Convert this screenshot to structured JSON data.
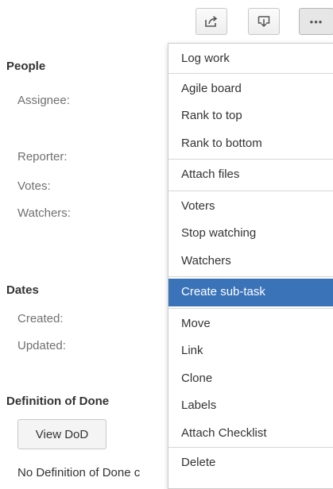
{
  "toolbar": {
    "buttons": [
      {
        "icon": "share-icon"
      },
      {
        "icon": "export-icon"
      },
      {
        "icon": "more-icon",
        "label": "•••"
      }
    ]
  },
  "people": {
    "title": "People",
    "assignee_label": "Assignee:",
    "reporter_label": "Reporter:",
    "votes_label": "Votes:",
    "watchers_label": "Watchers:"
  },
  "dates": {
    "title": "Dates",
    "created_label": "Created:",
    "updated_label": "Updated:"
  },
  "dod": {
    "title": "Definition of Done",
    "view_button": "View DoD",
    "empty_text": "No Definition of Done c"
  },
  "menu": {
    "groups": [
      [
        "Log work"
      ],
      [
        "Agile board",
        "Rank to top",
        "Rank to bottom"
      ],
      [
        "Attach files"
      ],
      [
        "Voters",
        "Stop watching",
        "Watchers"
      ],
      [
        "Create sub-task"
      ],
      [
        "Move",
        "Link",
        "Clone",
        "Labels",
        "Attach Checklist"
      ],
      [
        "Delete"
      ]
    ],
    "selected": "Create sub-task"
  },
  "colors": {
    "selected_bg": "#3b73b9",
    "selected_text": "#ffffff",
    "label_gray": "#707070"
  }
}
